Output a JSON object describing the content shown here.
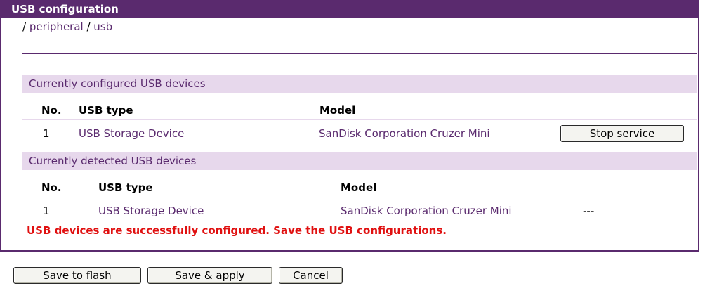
{
  "panel": {
    "title": "USB configuration"
  },
  "breadcrumb": {
    "sep1": "/ ",
    "link1": "peripheral",
    "sep2": " / ",
    "link2": "usb"
  },
  "configured": {
    "title": "Currently configured USB devices",
    "headers": {
      "no": "No.",
      "type": "USB type",
      "model": "Model"
    },
    "rows": [
      {
        "no": "1",
        "type": "USB Storage Device",
        "model": "SanDisk Corporation Cruzer Mini",
        "action": "Stop service"
      }
    ]
  },
  "detected": {
    "title": "Currently detected USB devices",
    "headers": {
      "no": "No.",
      "type": "USB type",
      "model": "Model"
    },
    "rows": [
      {
        "no": "1",
        "type": "USB Storage Device",
        "model": "SanDisk Corporation Cruzer Mini",
        "status": "---"
      }
    ]
  },
  "status_message": "USB devices are successfully configured. Save the USB configurations.",
  "buttons": {
    "save_flash": "Save to flash",
    "save_apply": "Save & apply",
    "cancel": "Cancel"
  },
  "colors": {
    "accent": "#5a2a6e",
    "section_bg": "#e7d8ec",
    "error": "#e01010"
  }
}
